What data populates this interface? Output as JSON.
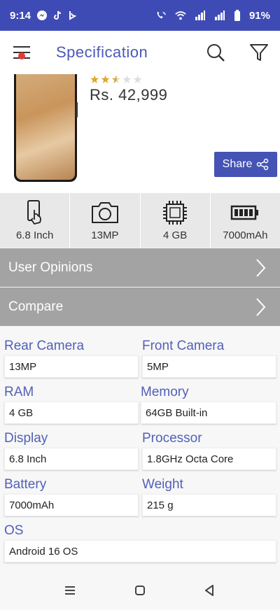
{
  "status_bar": {
    "time": "9:14",
    "battery": "91%"
  },
  "app_bar": {
    "title": "Specification"
  },
  "product": {
    "price": "Rs. 42,999",
    "rating_stars_filled": 2.5,
    "rating_stars_total": 5,
    "share_label": "Share"
  },
  "features": [
    {
      "icon": "touch-phone-icon",
      "label": "6.8 Inch"
    },
    {
      "icon": "camera-icon",
      "label": "13MP"
    },
    {
      "icon": "chip-icon",
      "label": "4 GB"
    },
    {
      "icon": "battery-icon",
      "label": "7000mAh"
    }
  ],
  "nav": {
    "user_opinions": "User Opinions",
    "compare": "Compare"
  },
  "specs": {
    "rear_camera": {
      "label": "Rear Camera",
      "value": "13MP"
    },
    "front_camera": {
      "label": "Front Camera",
      "value": "5MP"
    },
    "ram": {
      "label": "RAM",
      "value": "4 GB"
    },
    "memory": {
      "label": "Memory",
      "value": "64GB Built-in"
    },
    "display": {
      "label": "Display",
      "value": "6.8 Inch"
    },
    "processor": {
      "label": "Processor",
      "value": "1.8GHz Octa Core"
    },
    "battery": {
      "label": "Battery",
      "value": "7000mAh"
    },
    "weight": {
      "label": "Weight",
      "value": "215 g"
    },
    "os": {
      "label": "OS",
      "value": "Android 16 OS"
    }
  },
  "colors": {
    "brand": "#3f4bb5",
    "accent_text": "#5260b8",
    "nav_row_bg": "#a3a3a3",
    "star": "#e0a526"
  }
}
